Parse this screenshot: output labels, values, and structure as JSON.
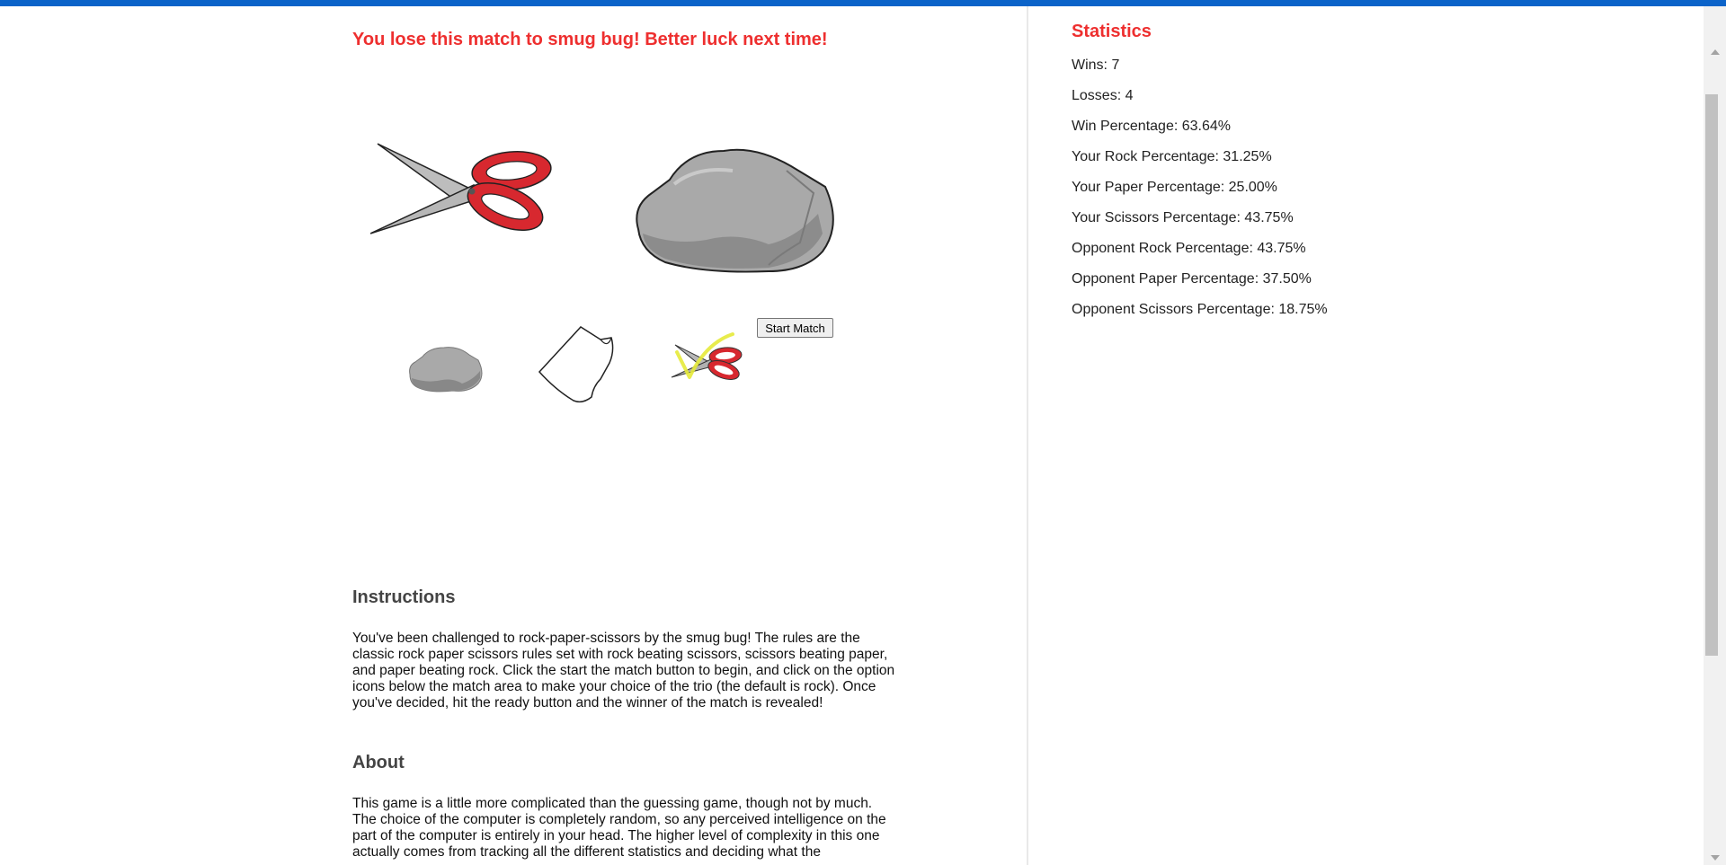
{
  "game": {
    "result_message": "You lose this match to smug bug! Better luck next time!",
    "player_choice": "scissors-icon",
    "opponent_choice": "rock-icon",
    "selected_option": "scissors",
    "start_button": "Start Match",
    "options": [
      "rock",
      "paper",
      "scissors"
    ]
  },
  "instructions": {
    "title": "Instructions",
    "text": "You've been challenged to rock-paper-scissors by the smug bug! The rules are the classic rock paper scissors rules set with rock beating scissors, scissors beating paper, and paper beating rock. Click the start the match button to begin, and click on the option icons below the match area to make your choice of the trio (the default is rock). Once you've decided, hit the ready button and the winner of the match is revealed!"
  },
  "about": {
    "title": "About",
    "text": "This game is a little more complicated than the guessing game, though not by much. The choice of the computer is completely random, so any perceived intelligence on the part of the computer is entirely in your head. The higher level of complexity in this one actually comes from tracking all the different statistics and deciding what the"
  },
  "statistics": {
    "title": "Statistics",
    "items": [
      "Wins: 7",
      "Losses: 4",
      "Win Percentage: 63.64%",
      "Your Rock Percentage: 31.25%",
      "Your Paper Percentage: 25.00%",
      "Your Scissors Percentage: 43.75%",
      "Opponent Rock Percentage: 43.75%",
      "Opponent Paper Percentage: 37.50%",
      "Opponent Scissors Percentage: 18.75%"
    ]
  },
  "colors": {
    "accent": "#ee2f2f",
    "top_bar": "#0b63c9",
    "scissors_handle": "#d7282f",
    "rock_fill": "#a9a9a9",
    "selection_check": "#e6ea3a"
  }
}
